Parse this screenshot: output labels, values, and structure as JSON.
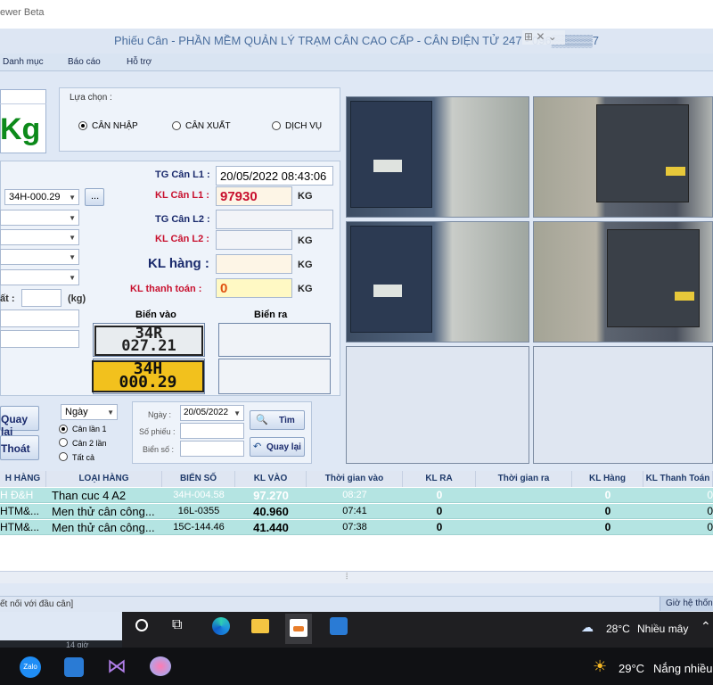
{
  "window": {
    "title": "ewer Beta",
    "controls": "⊞ ✕ ⌄"
  },
  "header": {
    "title": "Phiếu Cân - PHẦN MỀM QUẢN LÝ TRẠM CÂN CAO CẤP - CÂN ĐIỆN TỬ 247 - 096▒▒▒▒▒7"
  },
  "menu": {
    "items": [
      "Danh mục",
      "Báo cáo",
      "Hỗ trợ"
    ]
  },
  "weight_display": {
    "unit": "Kg"
  },
  "mode": {
    "legend": "Lựa chọn :",
    "options": [
      "CÂN NHẬP",
      "CÂN XUẤT",
      "DỊCH VỤ"
    ],
    "selected": "CÂN NHẬP"
  },
  "form": {
    "plate_select": "34H-000.29",
    "browse_label": "...",
    "partial_label": "ất :",
    "partial_unit": "(kg)",
    "tg_l1_label": "TG Cân L1 :",
    "tg_l1_value": "20/05/2022 08:43:06",
    "kl_l1_label": "KL Cân L1 :",
    "kl_l1_value": "97930",
    "tg_l2_label": "TG Cân L2 :",
    "kl_l2_label": "KL Cân L2 :",
    "kl_hang_label": "KL hàng :",
    "kl_thanhtoan_label": "KL thanh toán :",
    "kl_thanhtoan_value": "0",
    "unit_kg": "KG",
    "bien_vao_label": "Biển vào",
    "bien_ra_label": "Biển ra",
    "plate_in_white": {
      "line1": "34R",
      "line2": "027.21"
    },
    "plate_in_yellow": {
      "line1": "34H",
      "line2": "000.29"
    }
  },
  "actions": {
    "back": "Quay lại",
    "exit": "Thoát"
  },
  "filter": {
    "period": "Ngày",
    "options": [
      "Cân lần 1",
      "Cân 2 lần",
      "Tất cả"
    ],
    "selected": "Cân lần 1",
    "date_label": "Ngày :",
    "date_value": "20/05/2022",
    "slip_label": "Số phiếu :",
    "plate_label": "Biển số :",
    "search_label": "Tìm",
    "back_label": "Quay lại"
  },
  "table": {
    "columns": [
      "H HÀNG",
      "LOẠI HÀNG",
      "BIỂN SỐ",
      "KL VÀO",
      "Thời gian vào",
      "KL RA",
      "Thời gian ra",
      "KL Hàng",
      "KL Thanh Toán"
    ],
    "rows": [
      [
        "H Đ&H",
        "Than cuc 4 A2",
        "34H-004.58",
        "97.270",
        "08:27",
        "0",
        "",
        "0",
        "0"
      ],
      [
        "HTM&...",
        "Men thử cân công...",
        "16L-0355",
        "40.960",
        "07:41",
        "0",
        "",
        "0",
        "0"
      ],
      [
        "HTM&...",
        "Men thử cân công...",
        "15C-144.46",
        "41.440",
        "07:38",
        "0",
        "",
        "0",
        "0"
      ]
    ]
  },
  "status": {
    "left": "ết nối với đầu cân]",
    "right": "Giờ hệ thống"
  },
  "taskbar_upper": {
    "temp": "28°C",
    "weather": "Nhiều mây"
  },
  "taskbar_lower": {
    "partial": "14 giờ",
    "temp": "29°C",
    "weather": "Nắng nhiều"
  },
  "colors": {
    "accent": "#1a2a6c",
    "alert": "#c8102e",
    "row_bg": "#b4e4e2",
    "unit_green": "#0c8a1a"
  }
}
